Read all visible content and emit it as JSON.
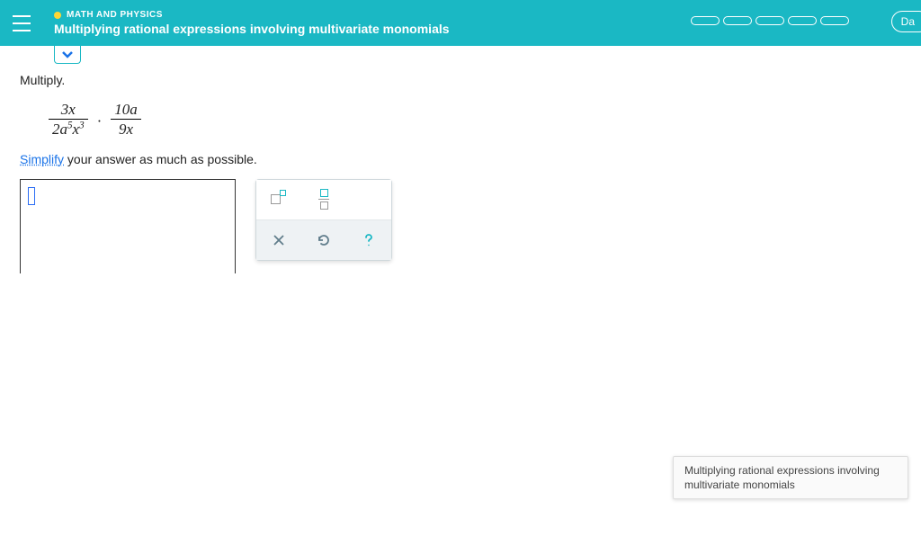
{
  "header": {
    "subject": "MATH AND PHYSICS",
    "title": "Multiplying rational expressions involving multivariate monomials",
    "pill": "Da"
  },
  "problem": {
    "prompt": "Multiply.",
    "frac1": {
      "num": "3x",
      "den_coef": "2a",
      "den_exp1": "5",
      "den_mid": "x",
      "den_exp2": "3"
    },
    "sep": "·",
    "frac2": {
      "num": "10a",
      "den": "9x"
    },
    "simplify_link": "Simplify",
    "simplify_rest": " your answer as much as possible."
  },
  "tooltip": "Multiplying rational expressions involving multivariate monomials"
}
